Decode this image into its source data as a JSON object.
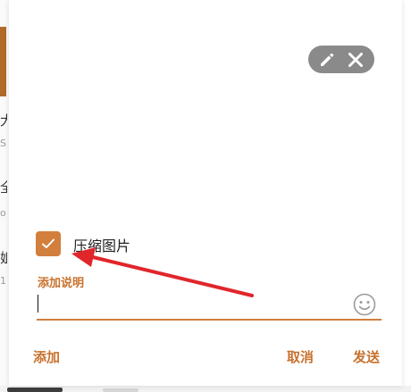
{
  "background": {
    "chars": [
      "大",
      "全",
      "姐"
    ],
    "subs": [
      "S",
      "ot",
      "1"
    ]
  },
  "dialog": {
    "toolbar": {
      "edit_icon": "pencil-icon",
      "close_icon": "close-icon",
      "pill_color": "#8a8a8a"
    },
    "compress": {
      "label": "压缩图片",
      "checked": true
    },
    "caption": {
      "label": "添加说明",
      "value": "",
      "emoji_icon": "smiley-icon"
    },
    "actions": {
      "add": "添加",
      "cancel": "取消",
      "send": "发送"
    }
  },
  "colors": {
    "accent": "#d27f3e",
    "accent_text": "#c8722e",
    "annotation": "#e0262b"
  }
}
